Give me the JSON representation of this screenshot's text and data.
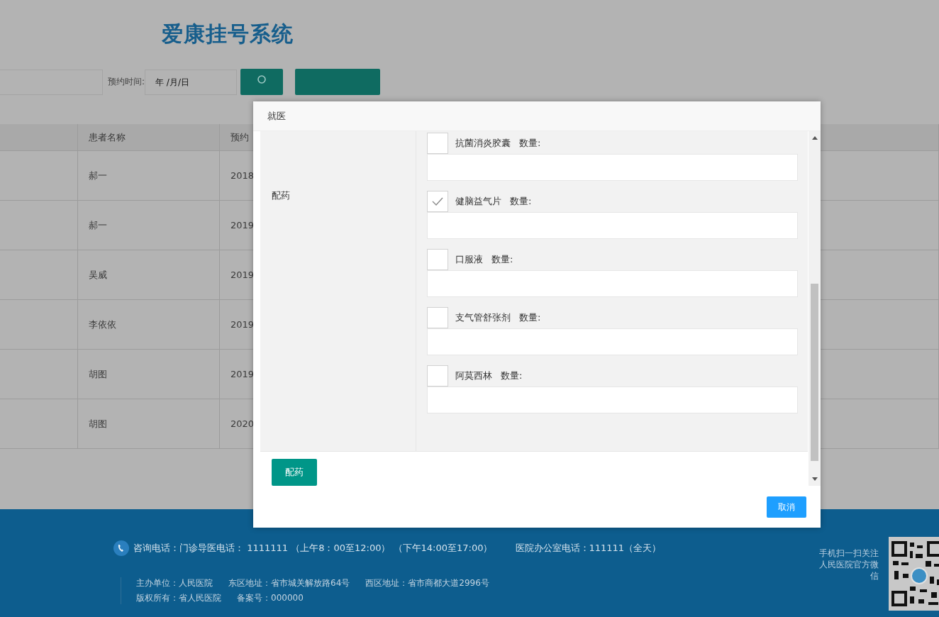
{
  "header": {
    "title": "爱康挂号系统"
  },
  "filters": {
    "date_label": "预约时间:",
    "date_placeholder": "年 /月/日"
  },
  "table": {
    "columns": [
      "患者名称",
      "预约"
    ],
    "rows": [
      {
        "patient": "郝一",
        "date": "2018"
      },
      {
        "patient": "郝一",
        "date": "2019"
      },
      {
        "patient": "吴威",
        "date": "2019"
      },
      {
        "patient": "李依依",
        "date": "2019"
      },
      {
        "patient": "胡图",
        "date": "2019"
      },
      {
        "patient": "胡图",
        "date": "2020"
      }
    ]
  },
  "dialog": {
    "title": "就医",
    "section_label": "配药",
    "medicines": [
      {
        "name": "抗菌消炎胶囊",
        "quantity_label": "数量:",
        "checked": false
      },
      {
        "name": "健脑益气片",
        "quantity_label": "数量:",
        "checked": true
      },
      {
        "name": "口服液",
        "quantity_label": "数量:",
        "checked": false
      },
      {
        "name": "支气管舒张剂",
        "quantity_label": "数量:",
        "checked": false
      },
      {
        "name": "阿莫西林",
        "quantity_label": "数量:",
        "checked": false
      }
    ],
    "submit_button": "配药",
    "cancel_button": "取消"
  },
  "footer": {
    "phone": "咨询电话：门诊导医电话： 1111111 （上午8：00至12:00） （下午14:00至17:00）",
    "office_phone": "医院办公室电话：111111（全天）",
    "info_lines": [
      [
        "主办单位：人民医院",
        "东区地址：省市城关解放路64号",
        "西区地址：省市商都大道2996号"
      ],
      [
        "版权所有：省人民医院",
        "备案号：000000"
      ]
    ],
    "qr_caption": "手机扫一扫关注人民医院官方微信"
  }
}
